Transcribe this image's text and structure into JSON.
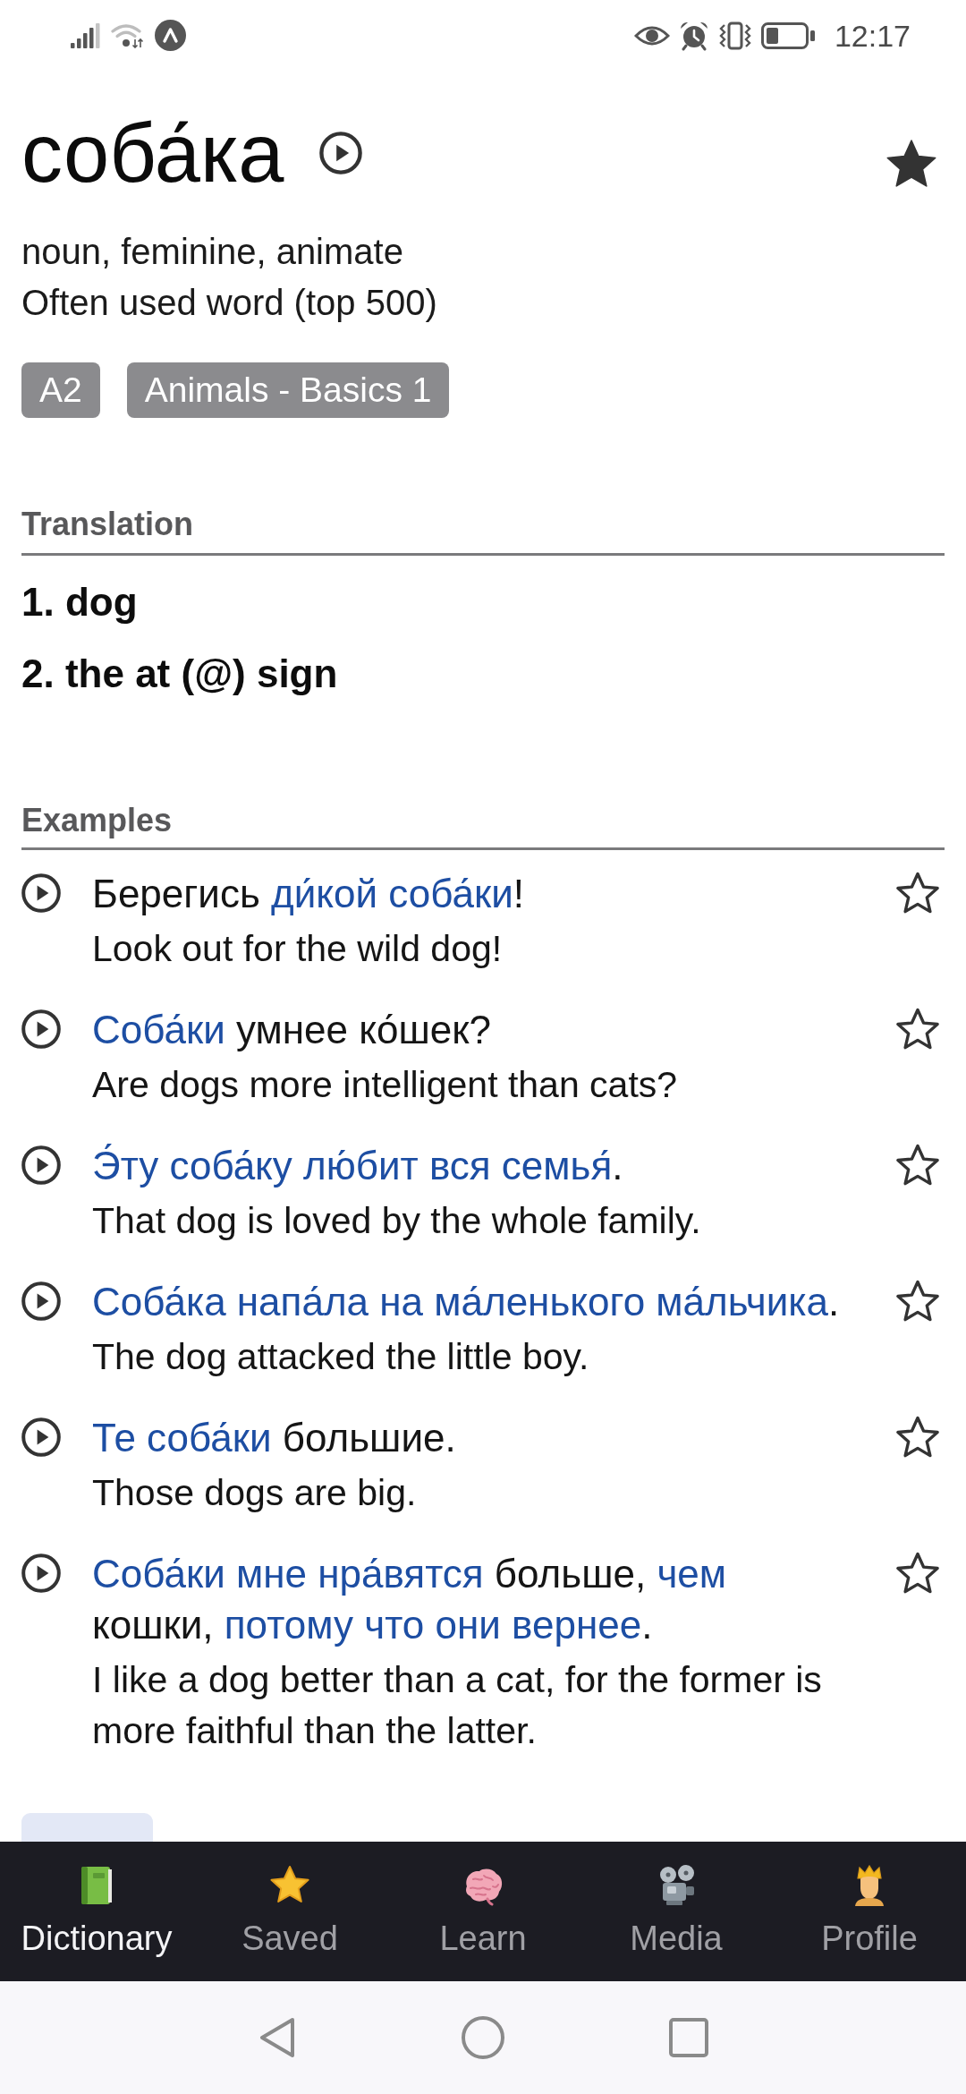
{
  "status_bar": {
    "time": "12:17"
  },
  "entry": {
    "headword": "соба́ка",
    "starred": true,
    "grammar": "noun, feminine, animate",
    "frequency": "Often used word (top 500)",
    "tags": [
      "A2",
      "Animals - Basics 1"
    ]
  },
  "translation": {
    "heading": "Translation",
    "meanings": [
      "1. dog",
      "2. the at (@) sign"
    ]
  },
  "examples": {
    "heading": "Examples",
    "items": [
      {
        "starred": false,
        "segments": [
          {
            "text": "Берегись ",
            "highlighted": false
          },
          {
            "text": "ди́кой соба́ки",
            "highlighted": true
          },
          {
            "text": "!",
            "highlighted": false
          }
        ],
        "translation": "Look out for the wild dog!"
      },
      {
        "starred": false,
        "segments": [
          {
            "text": "Соба́ки",
            "highlighted": true
          },
          {
            "text": " умнее ко́шек?",
            "highlighted": false
          }
        ],
        "translation": "Are dogs more intelligent than cats?"
      },
      {
        "starred": false,
        "segments": [
          {
            "text": "Э́ту соба́ку лю́бит вся семья́",
            "highlighted": true
          },
          {
            "text": ".",
            "highlighted": false
          }
        ],
        "translation": "That dog is loved by the whole family."
      },
      {
        "starred": false,
        "segments": [
          {
            "text": "Соба́ка напа́ла на ма́ленького ма́льчика",
            "highlighted": true
          },
          {
            "text": ".",
            "highlighted": false
          }
        ],
        "translation": "The dog attacked the little boy."
      },
      {
        "starred": false,
        "segments": [
          {
            "text": "Те соба́ки",
            "highlighted": true
          },
          {
            "text": " большие.",
            "highlighted": false
          }
        ],
        "translation": "Those dogs are big."
      },
      {
        "starred": false,
        "segments": [
          {
            "text": "Соба́ки мне нра́вятся",
            "highlighted": true
          },
          {
            "text": " больше, ",
            "highlighted": false
          },
          {
            "text": "чем",
            "highlighted": true
          },
          {
            "text": " кошки, ",
            "highlighted": false
          },
          {
            "text": "потому что они вернее",
            "highlighted": true
          },
          {
            "text": ".",
            "highlighted": false
          }
        ],
        "translation": "I like a dog better than a cat, for the former is more faithful than the latter."
      }
    ]
  },
  "bottom_nav": {
    "items": [
      {
        "label": "Dictionary",
        "selected": true
      },
      {
        "label": "Saved",
        "selected": false
      },
      {
        "label": "Learn",
        "selected": false
      },
      {
        "label": "Media",
        "selected": false
      },
      {
        "label": "Profile",
        "selected": false
      }
    ]
  }
}
